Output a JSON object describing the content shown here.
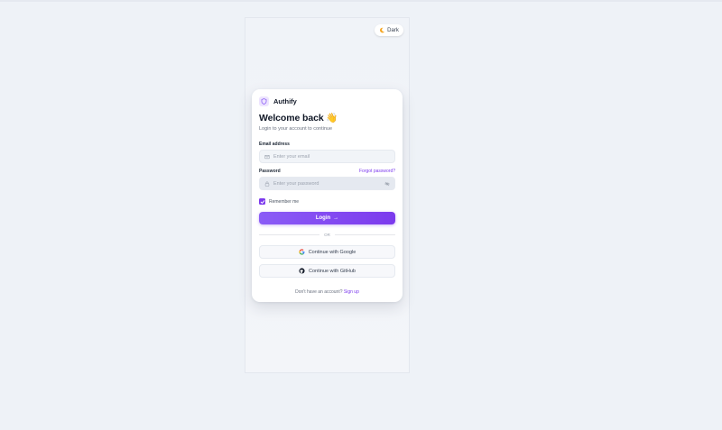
{
  "theme_toggle": {
    "icon": "moon-icon",
    "label": "Dark"
  },
  "brand": {
    "name": "Authify",
    "logo_icon": "shield-icon"
  },
  "login": {
    "title": "Welcome back 👋",
    "subtitle": "Login to your account to continue",
    "email": {
      "label": "Email address",
      "placeholder": "Enter your email",
      "value": ""
    },
    "password": {
      "label": "Password",
      "placeholder": "Enter your password",
      "value": "",
      "forgot_label": "Forgot password?"
    },
    "remember": {
      "label": "Remember me",
      "checked": true
    },
    "submit_label": "Login",
    "submit_arrow": "→",
    "divider_label": "OR",
    "google_label": "Continue with Google",
    "github_label": "Continue with GitHub",
    "footer_text": "Don't have an account?",
    "signup_label": "Sign up"
  },
  "colors": {
    "accent": "#7c3aed",
    "accent_light": "#8b5cf6",
    "background": "#eef2f7",
    "card": "#ffffff"
  }
}
